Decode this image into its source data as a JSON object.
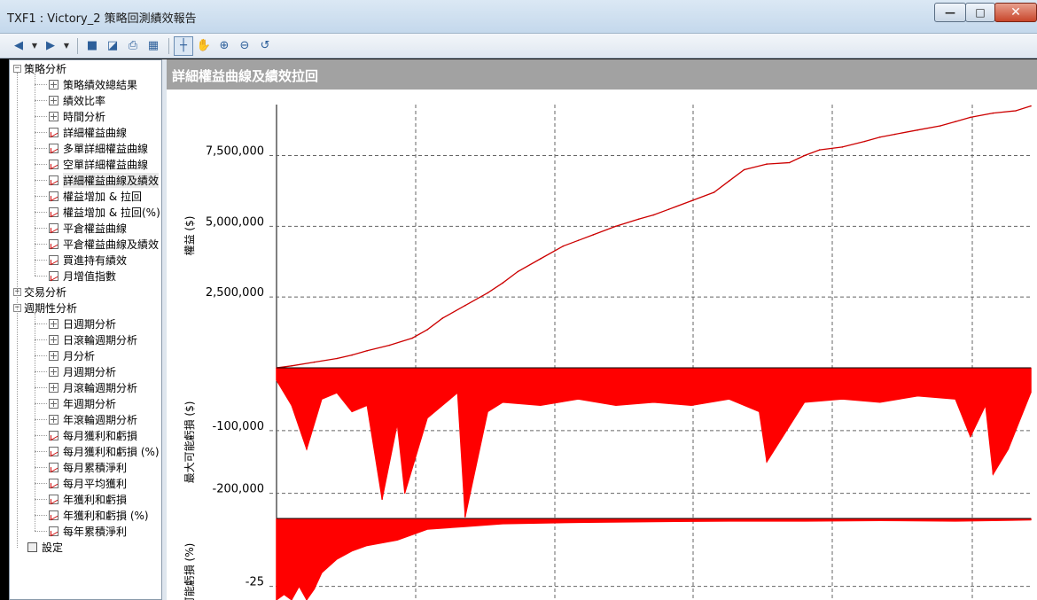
{
  "window": {
    "title": "TXF1 : Victory_2 策略回測績效報告",
    "minimize_glyph": "—",
    "maximize_glyph": "□",
    "close_glyph": "✕"
  },
  "toolbar": {
    "icons": [
      "back-icon",
      "dropdown-arrow-icon",
      "forward-icon",
      "dropdown-arrow-icon",
      "save-icon",
      "export-icon",
      "print-icon",
      "table-view-icon",
      "select-pointer-icon",
      "pan-hand-icon",
      "zoom-in-icon",
      "zoom-out-icon",
      "reset-zoom-icon"
    ]
  },
  "tree": {
    "items": [
      {
        "label": "策略分析",
        "level": 0,
        "expander": "−"
      },
      {
        "label": "策略績效總結果",
        "level": 1,
        "icon": "table"
      },
      {
        "label": "績效比率",
        "level": 1,
        "icon": "table"
      },
      {
        "label": "時間分析",
        "level": 1,
        "icon": "table"
      },
      {
        "label": "詳細權益曲線",
        "level": 1,
        "icon": "chart"
      },
      {
        "label": "多單詳細權益曲線",
        "level": 1,
        "icon": "chart"
      },
      {
        "label": "空單詳細權益曲線",
        "level": 1,
        "icon": "chart"
      },
      {
        "label": "詳細權益曲線及績效",
        "level": 1,
        "icon": "chart",
        "selected": true
      },
      {
        "label": "權益增加 & 拉回",
        "level": 1,
        "icon": "chart"
      },
      {
        "label": "權益增加 & 拉回(%)",
        "level": 1,
        "icon": "chart"
      },
      {
        "label": "平倉權益曲線",
        "level": 1,
        "icon": "chart"
      },
      {
        "label": "平倉權益曲線及績效",
        "level": 1,
        "icon": "chart"
      },
      {
        "label": "買進持有績效",
        "level": 1,
        "icon": "chart"
      },
      {
        "label": "月增值指數",
        "level": 1,
        "icon": "chart"
      },
      {
        "label": "交易分析",
        "level": 0,
        "expander": "+"
      },
      {
        "label": "週期性分析",
        "level": 0,
        "expander": "−"
      },
      {
        "label": "日週期分析",
        "level": 1,
        "icon": "table"
      },
      {
        "label": "日滾輪週期分析",
        "level": 1,
        "icon": "table"
      },
      {
        "label": "月分析",
        "level": 1,
        "icon": "table"
      },
      {
        "label": "月週期分析",
        "level": 1,
        "icon": "table"
      },
      {
        "label": "月滾輪週期分析",
        "level": 1,
        "icon": "table"
      },
      {
        "label": "年週期分析",
        "level": 1,
        "icon": "table"
      },
      {
        "label": "年滾輪週期分析",
        "level": 1,
        "icon": "table"
      },
      {
        "label": "每月獲利和虧損",
        "level": 1,
        "icon": "chart"
      },
      {
        "label": "每月獲利和虧損 (%)",
        "level": 1,
        "icon": "chart"
      },
      {
        "label": "每月累積淨利",
        "level": 1,
        "icon": "chart"
      },
      {
        "label": "每月平均獲利",
        "level": 1,
        "icon": "chart"
      },
      {
        "label": "年獲利和虧損",
        "level": 1,
        "icon": "chart"
      },
      {
        "label": "年獲利和虧損 (%)",
        "level": 1,
        "icon": "chart"
      },
      {
        "label": "每年累積淨利",
        "level": 1,
        "icon": "chart"
      },
      {
        "label": "設定",
        "level": 0,
        "icon": "gear"
      }
    ]
  },
  "panel": {
    "header": "詳細權益曲線及績效拉回"
  },
  "chart_data": [
    {
      "type": "line",
      "ylabel": "權益 ($)",
      "ytick_labels": [
        "7,500,000",
        "5,000,000",
        "2,500,000"
      ],
      "yticks": [
        7500000,
        5000000,
        2500000
      ],
      "ylim": [
        0,
        9300000
      ],
      "grid": true,
      "series": [
        {
          "color": "#cc0000",
          "x": [
            0,
            0.02,
            0.05,
            0.08,
            0.1,
            0.12,
            0.15,
            0.18,
            0.2,
            0.22,
            0.25,
            0.28,
            0.3,
            0.32,
            0.35,
            0.38,
            0.4,
            0.42,
            0.45,
            0.48,
            0.5,
            0.52,
            0.55,
            0.58,
            0.6,
            0.62,
            0.65,
            0.68,
            0.7,
            0.72,
            0.75,
            0.78,
            0.8,
            0.82,
            0.85,
            0.88,
            0.9,
            0.92,
            0.95,
            0.98,
            1.0
          ],
          "values": [
            0,
            70000,
            200000,
            330000,
            450000,
            600000,
            800000,
            1050000,
            1350000,
            1750000,
            2200000,
            2650000,
            3000000,
            3400000,
            3850000,
            4300000,
            4500000,
            4700000,
            5000000,
            5250000,
            5400000,
            5600000,
            5900000,
            6200000,
            6600000,
            7000000,
            7200000,
            7250000,
            7500000,
            7700000,
            7800000,
            8000000,
            8150000,
            8250000,
            8400000,
            8550000,
            8700000,
            8850000,
            9000000,
            9080000,
            9250000
          ]
        }
      ]
    },
    {
      "type": "area",
      "ylabel": "最大可能虧損 ($)",
      "ytick_labels": [
        "-100,000",
        "-200,000"
      ],
      "yticks": [
        -100000,
        -200000
      ],
      "ylim": [
        -240000,
        0
      ],
      "grid": true,
      "series": [
        {
          "color": "#ff0000",
          "x": [
            0,
            0.02,
            0.04,
            0.06,
            0.08,
            0.1,
            0.12,
            0.14,
            0.16,
            0.17,
            0.2,
            0.22,
            0.24,
            0.25,
            0.28,
            0.3,
            0.35,
            0.4,
            0.45,
            0.5,
            0.55,
            0.6,
            0.64,
            0.65,
            0.7,
            0.75,
            0.8,
            0.85,
            0.9,
            0.92,
            0.94,
            0.95,
            0.97,
            1.0
          ],
          "values": [
            -20000,
            -60000,
            -130000,
            -50000,
            -40000,
            -70000,
            -60000,
            -210000,
            -90000,
            -200000,
            -80000,
            -60000,
            -40000,
            -238000,
            -70000,
            -55000,
            -60000,
            -50000,
            -60000,
            -55000,
            -60000,
            -50000,
            -70000,
            -150000,
            -55000,
            -50000,
            -55000,
            -45000,
            -50000,
            -110000,
            -60000,
            -170000,
            -130000,
            -40000
          ]
        }
      ]
    },
    {
      "type": "area",
      "ylabel": "最大可能虧損 (%)",
      "ytick_labels": [
        "-25"
      ],
      "yticks": [
        -25
      ],
      "ylim": [
        -30,
        0
      ],
      "grid": true,
      "series": [
        {
          "color": "#ff0000",
          "x": [
            0,
            0.01,
            0.02,
            0.03,
            0.04,
            0.05,
            0.06,
            0.08,
            0.1,
            0.12,
            0.14,
            0.16,
            0.18,
            0.2,
            0.25,
            0.3,
            0.4,
            0.5,
            0.6,
            0.7,
            0.8,
            0.9,
            1.0
          ],
          "values": [
            -30,
            -28,
            -30,
            -25,
            -30,
            -26,
            -20,
            -15,
            -12,
            -10,
            -9,
            -8,
            -6,
            -4,
            -3,
            -2,
            -1.5,
            -1.2,
            -1,
            -1,
            -0.8,
            -1,
            -0.6
          ]
        }
      ]
    }
  ]
}
